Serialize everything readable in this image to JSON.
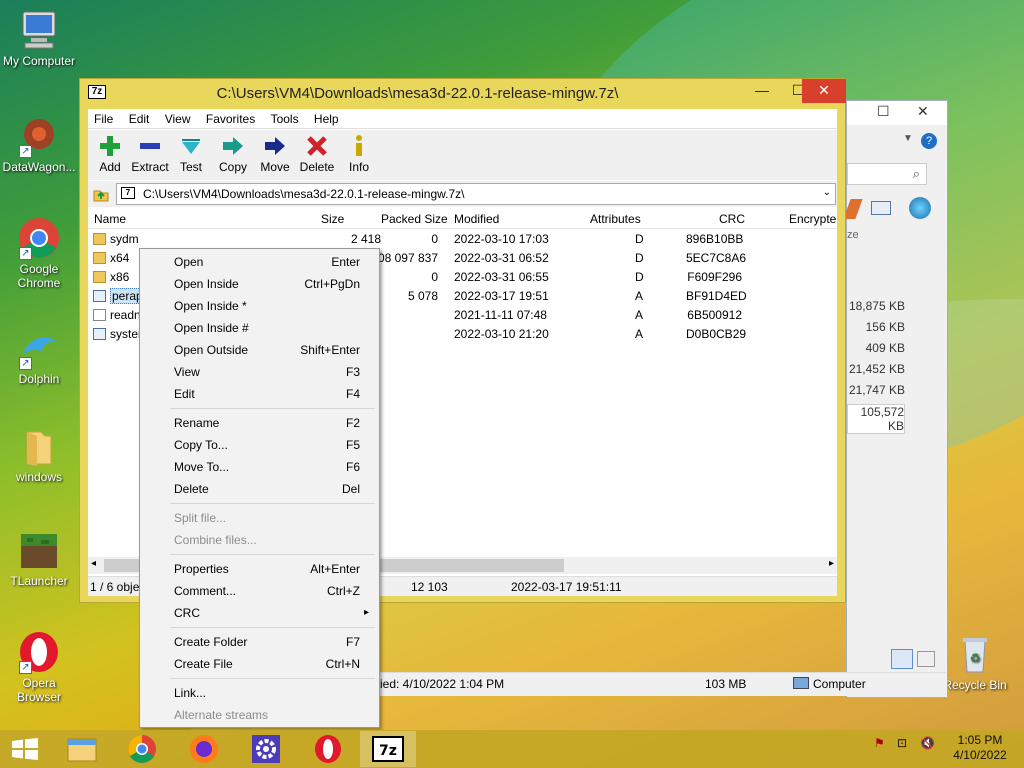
{
  "desktop": {
    "icons": [
      "My Computer",
      "DataWagon...",
      "Google Chrome",
      "Dolphin",
      "windows",
      "TLauncher",
      "Opera Browser"
    ],
    "recycle_bin": "Recycle Bin"
  },
  "explorer_back": {
    "sizes": [
      "18,875 KB",
      "156 KB",
      "409 KB",
      "21,452 KB",
      "21,747 KB",
      "105,572 KB"
    ],
    "col_fragment": "ze",
    "status_modified": "ied: 4/10/2022 1:04 PM",
    "status_size": "103 MB",
    "status_location": "Computer"
  },
  "window": {
    "title": "C:\\Users\\VM4\\Downloads\\mesa3d-22.0.1-release-mingw.7z\\",
    "menu": [
      "File",
      "Edit",
      "View",
      "Favorites",
      "Tools",
      "Help"
    ],
    "toolbar": [
      "Add",
      "Extract",
      "Test",
      "Copy",
      "Move",
      "Delete",
      "Info"
    ],
    "address": "C:\\Users\\VM4\\Downloads\\mesa3d-22.0.1-release-mingw.7z\\",
    "columns": {
      "name": "Name",
      "size": "Size",
      "packed": "Packed Size",
      "modified": "Modified",
      "attributes": "Attributes",
      "crc": "CRC",
      "encrypted": "Encrypte"
    },
    "rows": [
      {
        "name": "sydm",
        "size": "2 418",
        "packed": "0",
        "modified": "2022-03-10 17:03",
        "attr": "D",
        "crc": "896B10BB",
        "type": "folder"
      },
      {
        "name": "x64",
        "size": "",
        "packed": "108 097 837",
        "modified": "2022-03-31 06:52",
        "attr": "D",
        "crc": "5EC7C8A6",
        "type": "folder"
      },
      {
        "name": "x86",
        "size": "",
        "packed": "0",
        "modified": "2022-03-31 06:55",
        "attr": "D",
        "crc": "F609F296",
        "type": "folder"
      },
      {
        "name": "perap",
        "size": "",
        "packed": "5 078",
        "modified": "2022-03-17 19:51",
        "attr": "A",
        "crc": "BF91D4ED",
        "type": "cmd"
      },
      {
        "name": "readn",
        "size": "",
        "packed": "",
        "modified": "2021-11-11 07:48",
        "attr": "A",
        "crc": "6B500912",
        "type": "txt"
      },
      {
        "name": "syster",
        "size": "",
        "packed": "",
        "modified": "2022-03-10 21:20",
        "attr": "A",
        "crc": "D0B0CB29",
        "type": "cmd"
      }
    ],
    "status": {
      "count": "1 / 6 objec",
      "size": "12 103",
      "modified": "2022-03-17 19:51:11"
    }
  },
  "context_menu": [
    {
      "label": "Open",
      "shortcut": "Enter"
    },
    {
      "label": "Open Inside",
      "shortcut": "Ctrl+PgDn"
    },
    {
      "label": "Open Inside *",
      "shortcut": ""
    },
    {
      "label": "Open Inside #",
      "shortcut": ""
    },
    {
      "label": "Open Outside",
      "shortcut": "Shift+Enter"
    },
    {
      "label": "View",
      "shortcut": "F3"
    },
    {
      "label": "Edit",
      "shortcut": "F4"
    },
    {
      "label": "Rename",
      "shortcut": "F2"
    },
    {
      "label": "Copy To...",
      "shortcut": "F5"
    },
    {
      "label": "Move To...",
      "shortcut": "F6"
    },
    {
      "label": "Delete",
      "shortcut": "Del"
    },
    {
      "label": "Split file...",
      "shortcut": "",
      "disabled": true
    },
    {
      "label": "Combine files...",
      "shortcut": "",
      "disabled": true
    },
    {
      "label": "Properties",
      "shortcut": "Alt+Enter"
    },
    {
      "label": "Comment...",
      "shortcut": "Ctrl+Z"
    },
    {
      "label": "CRC",
      "shortcut": "▸"
    },
    {
      "label": "Create Folder",
      "shortcut": "F7"
    },
    {
      "label": "Create File",
      "shortcut": "Ctrl+N"
    },
    {
      "label": "Link...",
      "shortcut": ""
    },
    {
      "label": "Alternate streams",
      "shortcut": "",
      "disabled": true
    }
  ],
  "taskbar": {
    "apps": [
      "file-explorer-icon",
      "chrome-icon",
      "firefox-icon",
      "settings-icon",
      "opera-icon",
      "7zip-icon"
    ],
    "active_app": "7zip-icon",
    "time": "1:05 PM",
    "date": "4/10/2022"
  }
}
